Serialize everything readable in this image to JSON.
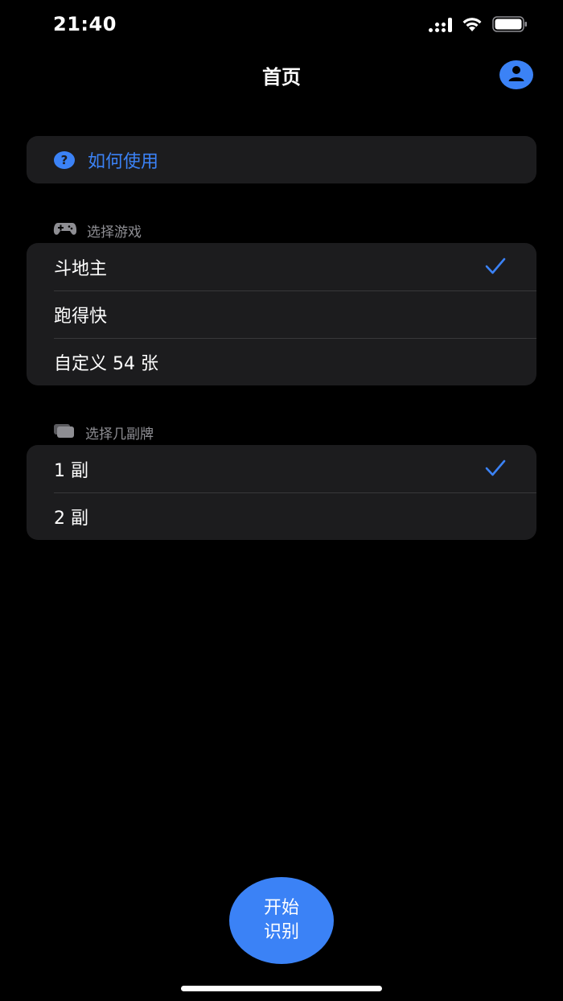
{
  "status_bar": {
    "time": "21:40"
  },
  "nav": {
    "title": "首页",
    "profile_icon": "person-icon"
  },
  "help": {
    "label": "如何使用",
    "icon": "question-circle-icon"
  },
  "game_section": {
    "header": "选择游戏",
    "icon": "gamecontroller-icon",
    "options": [
      {
        "label": "斗地主",
        "selected": true
      },
      {
        "label": "跑得快",
        "selected": false
      },
      {
        "label": "自定义 54 张",
        "selected": false
      }
    ]
  },
  "deck_section": {
    "header": "选择几副牌",
    "icon": "cards-stack-icon",
    "options": [
      {
        "label": "1 副",
        "selected": true
      },
      {
        "label": "2 副",
        "selected": false
      }
    ]
  },
  "start_button": {
    "label": "开始\n识别"
  },
  "colors": {
    "accent": "#3b82f6",
    "background": "#000000",
    "card": "#1c1c1e",
    "secondary_text": "#8e8e93"
  }
}
